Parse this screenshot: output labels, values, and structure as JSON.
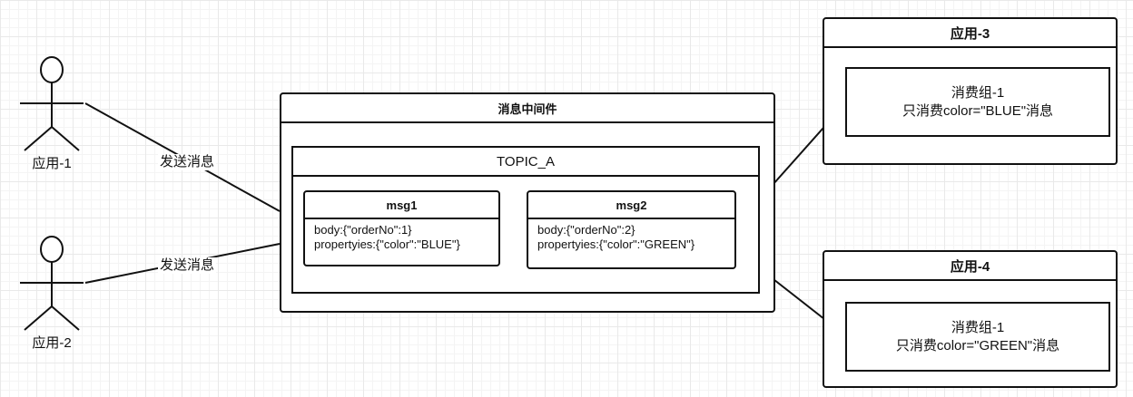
{
  "actors": [
    {
      "label": "应用-1"
    },
    {
      "label": "应用-2"
    }
  ],
  "edges": {
    "send1": "发送消息",
    "send2": "发送消息"
  },
  "middleware": {
    "title": "消息中间件",
    "topic": {
      "title": "TOPIC_A",
      "messages": [
        {
          "title": "msg1",
          "body": "body:{\"orderNo\":1}",
          "properties": "propertyies:{\"color\":\"BLUE\"}"
        },
        {
          "title": "msg2",
          "body": "body:{\"orderNo\":2}",
          "properties": "propertyies:{\"color\":\"GREEN\"}"
        }
      ]
    }
  },
  "apps": [
    {
      "title": "应用-3",
      "group": {
        "name": "消费组-1",
        "filter": "只消费color=\"BLUE\"消息"
      }
    },
    {
      "title": "应用-4",
      "group": {
        "name": "消费组-1",
        "filter": "只消费color=\"GREEN\"消息"
      }
    }
  ],
  "colors": {
    "stroke": "#111111",
    "background": "#ffffff",
    "grid": "#e9e9e9"
  }
}
